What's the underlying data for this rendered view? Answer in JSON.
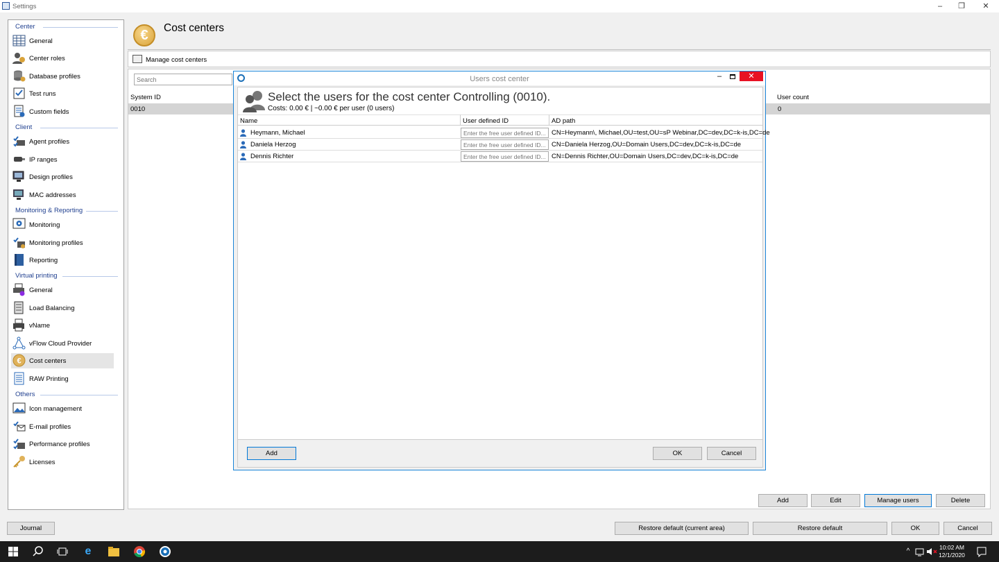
{
  "window": {
    "title": "Settings"
  },
  "sidebar": {
    "sections": [
      {
        "label": "Center",
        "items": [
          "General",
          "Center roles",
          "Database profiles",
          "Test runs",
          "Custom fields"
        ]
      },
      {
        "label": "Client",
        "items": [
          "Agent profiles",
          "IP ranges",
          "Design profiles",
          "MAC addresses"
        ]
      },
      {
        "label": "Monitoring & Reporting",
        "items": [
          "Monitoring",
          "Monitoring profiles",
          "Reporting"
        ]
      },
      {
        "label": "Virtual printing",
        "items": [
          "General",
          "Load Balancing",
          "vName",
          "vFlow Cloud Provider",
          "Cost centers",
          "RAW Printing"
        ]
      },
      {
        "label": "Others",
        "items": [
          "Icon management",
          "E-mail profiles",
          "Performance profiles",
          "Licenses"
        ]
      }
    ],
    "selected": "Cost centers"
  },
  "page": {
    "title": "Cost centers",
    "manage_label": "Manage cost centers",
    "search_placeholder": "Search",
    "grid": {
      "columns": [
        "System ID",
        "User count"
      ],
      "rows": [
        {
          "system_id": "0010",
          "user_count": "0"
        }
      ]
    },
    "buttons": {
      "add": "Add",
      "edit": "Edit",
      "manage_users": "Manage users",
      "delete": "Delete"
    }
  },
  "dialog": {
    "title": "Users cost center",
    "heading": "Select the users for the cost center Controlling (0010).",
    "subheading": "Costs: 0.00 € | ~0.00 € per user (0 users)",
    "columns": {
      "name": "Name",
      "user_id": "User defined ID",
      "ad_path": "AD path"
    },
    "user_id_placeholder": "Enter the free user defined ID...",
    "rows": [
      {
        "name": "Heymann, Michael",
        "ad_path": "CN=Heymann\\, Michael,OU=test,OU=sP Webinar,DC=dev,DC=k-is,DC=de"
      },
      {
        "name": "Daniela Herzog",
        "ad_path": "CN=Daniela Herzog,OU=Domain Users,DC=dev,DC=k-is,DC=de"
      },
      {
        "name": "Dennis Richter",
        "ad_path": "CN=Dennis Richter,OU=Domain Users,DC=dev,DC=k-is,DC=de"
      }
    ],
    "buttons": {
      "add": "Add",
      "ok": "OK",
      "cancel": "Cancel"
    }
  },
  "bottom": {
    "journal": "Journal",
    "restore_current": "Restore default (current area)",
    "restore_default": "Restore default",
    "ok": "OK",
    "cancel": "Cancel"
  },
  "taskbar": {
    "time": "10:02 AM",
    "date": "12/1/2020"
  },
  "colors": {
    "accent": "#0078d7",
    "section": "#1f3f8f",
    "close": "#e81123",
    "selection": "#d4d4d4"
  }
}
